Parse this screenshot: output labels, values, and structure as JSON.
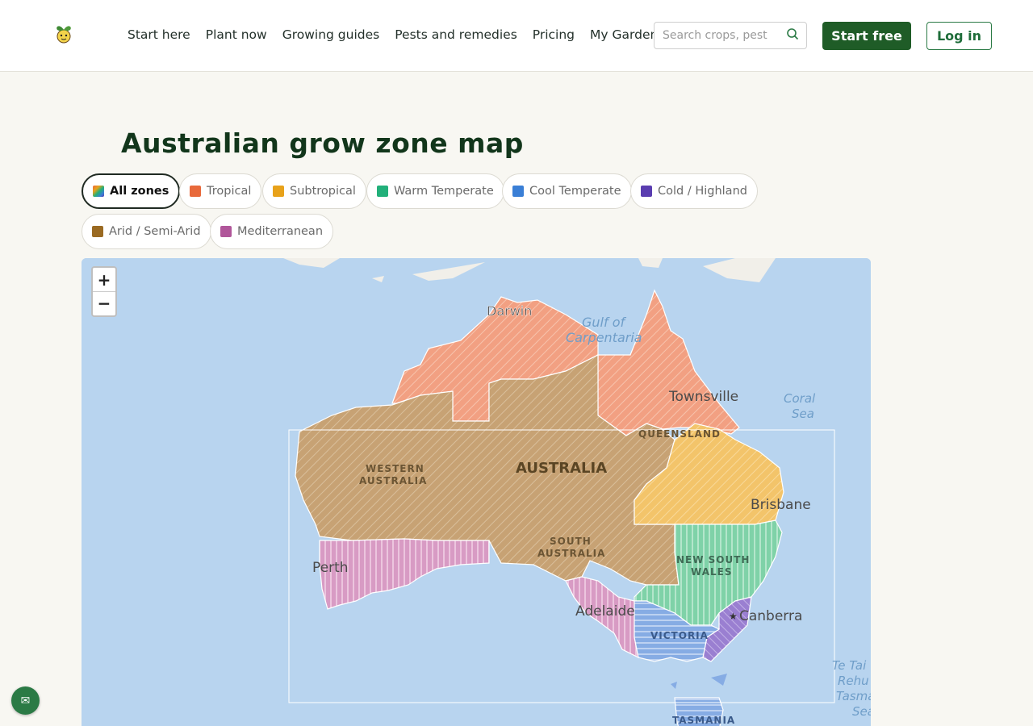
{
  "header": {
    "nav": [
      "Start here",
      "Plant now",
      "Growing guides",
      "Pests and remedies",
      "Pricing",
      "My Garden"
    ],
    "search_placeholder": "Search crops, pest",
    "search_icon": "search-icon",
    "start_label": "Start free",
    "login_label": "Log in",
    "brand_color": "#1f5c27"
  },
  "page": {
    "title": "Australian grow zone map"
  },
  "filters": [
    {
      "label": "All zones",
      "color": "multi",
      "active": true
    },
    {
      "label": "Tropical",
      "color": "#e8693b"
    },
    {
      "label": "Subtropical",
      "color": "#e8a21a"
    },
    {
      "label": "Warm Temperate",
      "color": "#22b07a"
    },
    {
      "label": "Cool Temperate",
      "color": "#3a7fd6"
    },
    {
      "label": "Cold / Highland",
      "color": "#5a3db0"
    },
    {
      "label": "Arid / Semi-Arid",
      "color": "#9a6a22"
    },
    {
      "label": "Mediterranean",
      "color": "#b0569a"
    }
  ],
  "map": {
    "zoom_in": "+",
    "zoom_out": "−",
    "labels": {
      "darwin": "Darwin",
      "gulf1": "Gulf of",
      "gulf2": "Carpentaria",
      "townsville": "Townsville",
      "coral1": "Coral",
      "coral2": "Sea",
      "queensland": "QUEENSLAND",
      "australia": "AUSTRALIA",
      "wa1": "WESTERN",
      "wa2": "AUSTRALIA",
      "brisbane": "Brisbane",
      "sa1": "SOUTH",
      "sa2": "AUSTRALIA",
      "nsw1": "NEW SOUTH",
      "nsw2": "WALES",
      "perth": "Perth",
      "adelaide": "Adelaide",
      "canberra": "Canberra",
      "victoria": "VICTORIA",
      "tasmania": "TASMANIA",
      "tasman1": "Te Tai",
      "tasman2": "Rehu",
      "tasman3": "Tasman",
      "tasman4": "Sea"
    }
  },
  "feedback_icon": "mail-icon"
}
